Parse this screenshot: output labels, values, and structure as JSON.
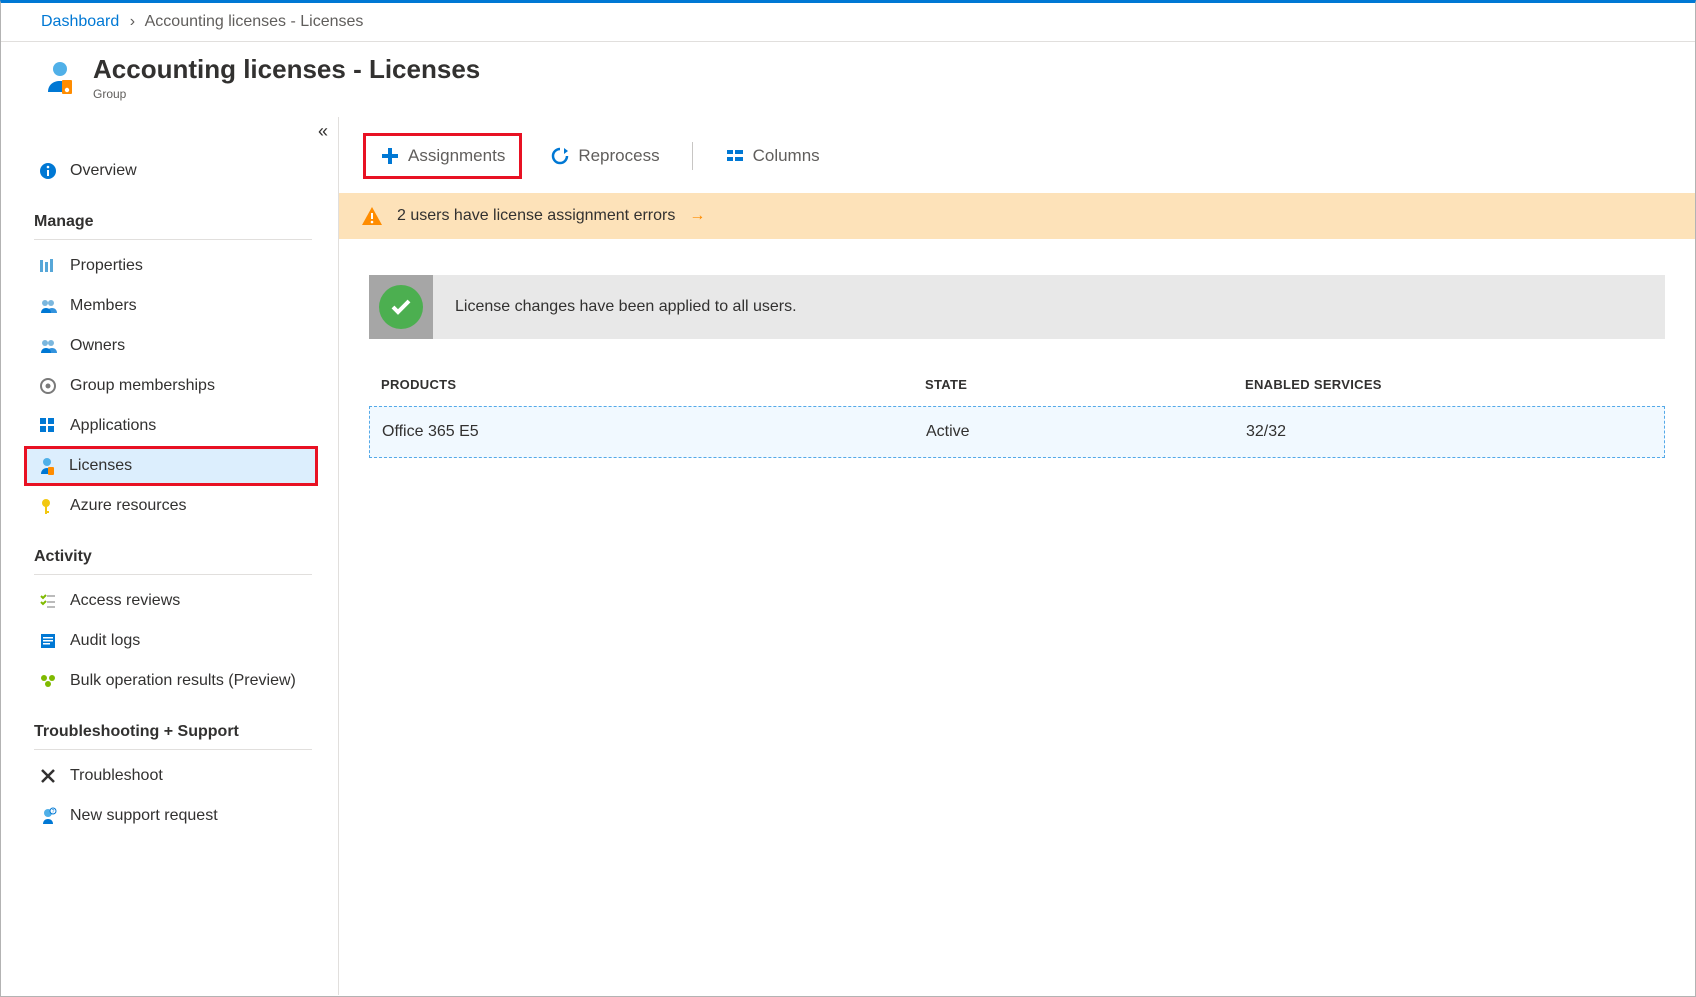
{
  "breadcrumb": {
    "root": "Dashboard",
    "current": "Accounting licenses - Licenses"
  },
  "header": {
    "title": "Accounting licenses - Licenses",
    "subtitle": "Group"
  },
  "sidebar": {
    "overview": "Overview",
    "groups": {
      "manage": {
        "title": "Manage",
        "items": {
          "properties": "Properties",
          "members": "Members",
          "owners": "Owners",
          "groupMemberships": "Group memberships",
          "applications": "Applications",
          "licenses": "Licenses",
          "azureResources": "Azure resources"
        }
      },
      "activity": {
        "title": "Activity",
        "items": {
          "accessReviews": "Access reviews",
          "auditLogs": "Audit logs",
          "bulkOps": "Bulk operation results (Preview)"
        }
      },
      "support": {
        "title": "Troubleshooting + Support",
        "items": {
          "troubleshoot": "Troubleshoot",
          "newSupport": "New support request"
        }
      }
    }
  },
  "toolbar": {
    "assignments": "Assignments",
    "reprocess": "Reprocess",
    "columns": "Columns"
  },
  "banners": {
    "warning": "2 users have license assignment errors",
    "success": "License changes have been applied to all users."
  },
  "table": {
    "headers": {
      "products": "PRODUCTS",
      "state": "STATE",
      "services": "ENABLED SERVICES"
    },
    "row": {
      "product": "Office 365 E5",
      "state": "Active",
      "services": "32/32"
    }
  }
}
